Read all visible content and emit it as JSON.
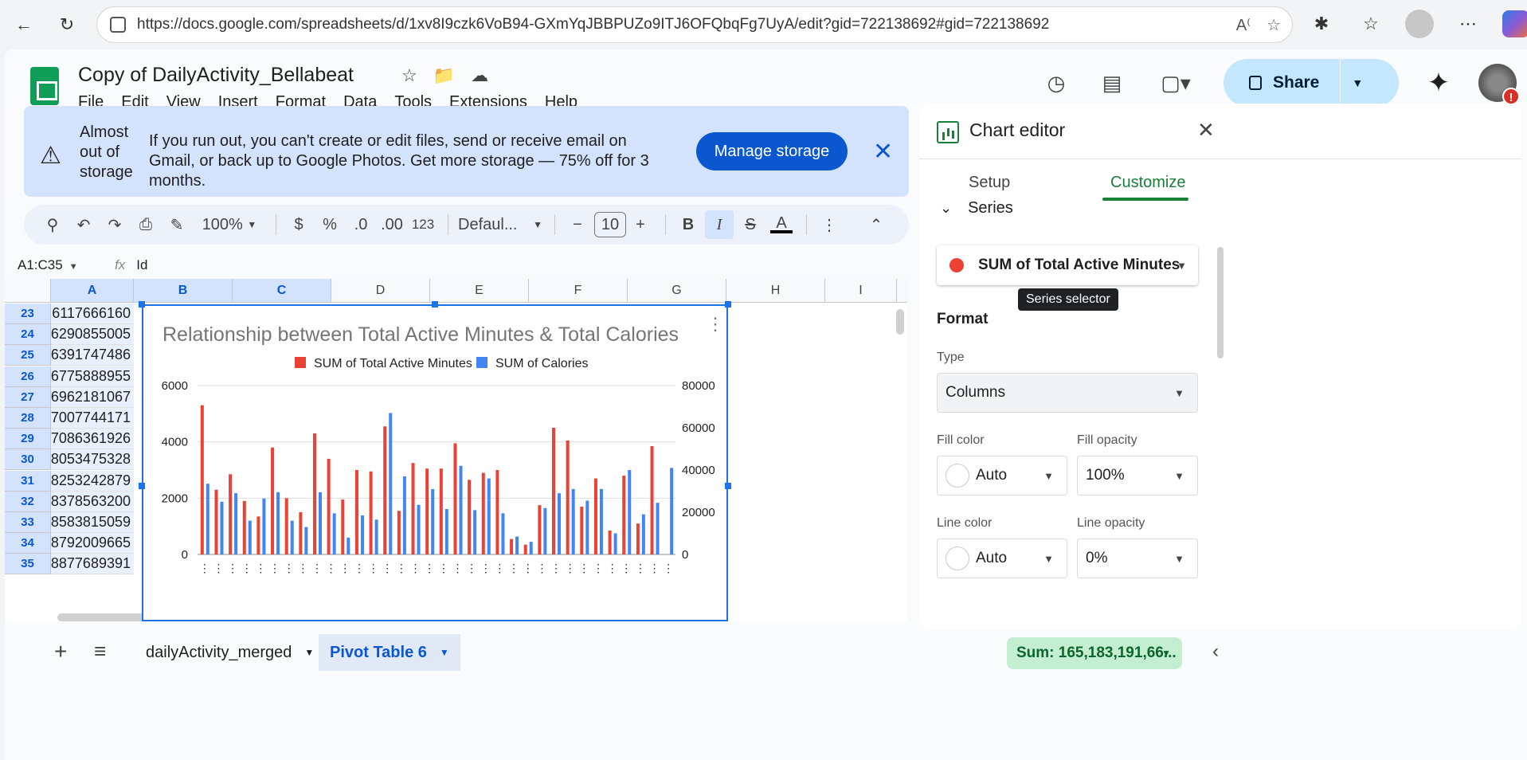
{
  "browser": {
    "url": "https://docs.google.com/spreadsheets/d/1xv8I9czk6VoB94-GXmYqJBBPUZo9ITJ6OFQbqFg7UyA/edit?gid=722138692#gid=722138692"
  },
  "doc": {
    "title": "Copy of DailyActivity_Bellabeat",
    "menu": [
      "File",
      "Edit",
      "View",
      "Insert",
      "Format",
      "Data",
      "Tools",
      "Extensions",
      "Help"
    ],
    "share_label": "Share"
  },
  "banner": {
    "title": "Almost out of storage",
    "text": "If you run out, you can't create or edit files, send or receive email on Gmail, or back up to Google Photos. Get more storage — 75% off for 3 months.",
    "button": "Manage storage"
  },
  "toolbar": {
    "zoom": "100%",
    "currency": "$",
    "percent": "%",
    "dec_decrease": ".0",
    "dec_increase": ".00",
    "number_format": "123",
    "font": "Defaul...",
    "font_size": "10",
    "bold": "B",
    "italic": "I",
    "text_color": "A"
  },
  "formula": {
    "namebox": "A1:C35",
    "fx": "fx",
    "value": "Id"
  },
  "grid": {
    "columns": [
      "A",
      "B",
      "C",
      "D",
      "E",
      "F",
      "G",
      "H",
      "I"
    ],
    "rows": [
      {
        "num": "23",
        "a": "6117666160"
      },
      {
        "num": "24",
        "a": "6290855005"
      },
      {
        "num": "25",
        "a": "6391747486"
      },
      {
        "num": "26",
        "a": "6775888955"
      },
      {
        "num": "27",
        "a": "6962181067"
      },
      {
        "num": "28",
        "a": "7007744171"
      },
      {
        "num": "29",
        "a": "7086361926"
      },
      {
        "num": "30",
        "a": "8053475328"
      },
      {
        "num": "31",
        "a": "8253242879"
      },
      {
        "num": "32",
        "a": "8378563200"
      },
      {
        "num": "33",
        "a": "8583815059"
      },
      {
        "num": "34",
        "a": "8792009665"
      },
      {
        "num": "35",
        "a": "8877689391"
      }
    ]
  },
  "chart_data": {
    "type": "bar",
    "title": "Relationship between Total Active Minutes & Total Calories",
    "legend_position": "top",
    "grid": true,
    "y_left_ticks": [
      "0",
      "2000",
      "4000",
      "6000"
    ],
    "y_right_ticks": [
      "0",
      "20000",
      "40000",
      "60000",
      "80000"
    ],
    "ylim_left": [
      0,
      6000
    ],
    "ylim_right": [
      0,
      80000
    ],
    "series": [
      {
        "name": "SUM of Total Active Minutes",
        "color": "#ea4335",
        "axis": "left",
        "values": [
          5300,
          2300,
          2850,
          1900,
          1350,
          3800,
          2000,
          1500,
          4300,
          3400,
          1950,
          3000,
          2950,
          4550,
          1550,
          3250,
          3050,
          3050,
          3950,
          2650,
          2900,
          3000,
          550,
          350,
          1750,
          4500,
          4050,
          1700,
          2700,
          850,
          2800,
          1100,
          3850
        ]
      },
      {
        "name": "SUM of Calories",
        "color": "#4285f4",
        "axis": "right",
        "values": [
          33500,
          25000,
          29000,
          16000,
          26500,
          29500,
          16000,
          13000,
          29500,
          19500,
          8000,
          18500,
          16500,
          67000,
          37000,
          23500,
          31000,
          21500,
          42000,
          21000,
          36000,
          19500,
          8500,
          6000,
          22000,
          29000,
          31000,
          25500,
          31000,
          10000,
          40000,
          19000,
          24500,
          41000
        ]
      }
    ]
  },
  "editor": {
    "title": "Chart editor",
    "tab_setup": "Setup",
    "tab_customize": "Customize",
    "section": "Series",
    "series_selected": "SUM of Total Active Minutes",
    "tooltip": "Series selector",
    "format_label": "Format",
    "type_label": "Type",
    "type_value": "Columns",
    "fill_color_label": "Fill color",
    "fill_color_value": "Auto",
    "fill_opacity_label": "Fill opacity",
    "fill_opacity_value": "100%",
    "line_color_label": "Line color",
    "line_color_value": "Auto",
    "line_opacity_label": "Line opacity",
    "line_opacity_value": "0%"
  },
  "sheets": {
    "tab1": "dailyActivity_merged",
    "tab2": "Pivot Table 6",
    "sum": "Sum: 165,183,191,66..."
  }
}
